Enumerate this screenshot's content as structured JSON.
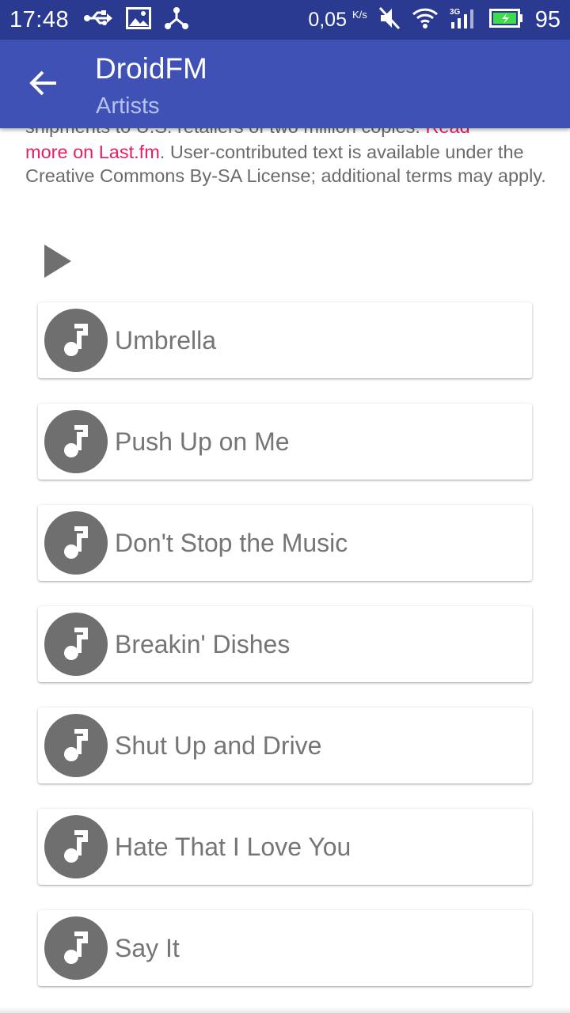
{
  "status_bar": {
    "time": "17:48",
    "speed_value": "0,05",
    "speed_unit": "K/s",
    "battery_level": "95",
    "icons": [
      "usb-icon",
      "image-icon",
      "share-icon",
      "mute-icon",
      "wifi-icon",
      "signal-3g-icon",
      "battery-charging-icon"
    ]
  },
  "app_bar": {
    "title": "DroidFM",
    "subtitle": "Artists",
    "back_icon": "arrow-back-icon"
  },
  "bio": {
    "clipped_text": "shipments to U.S. retailers of two million copies.",
    "read_more_clipped": "Read",
    "read_more": "more on Last.fm",
    "license_text": ". User-contributed text is available under the Creative Commons By-SA License; additional terms may apply."
  },
  "play_icon": "play-icon",
  "tracks": [
    {
      "title": "Umbrella",
      "icon": "music-note-icon"
    },
    {
      "title": "Push Up on Me",
      "icon": "music-note-icon"
    },
    {
      "title": "Don't Stop the Music",
      "icon": "music-note-icon"
    },
    {
      "title": "Breakin' Dishes",
      "icon": "music-note-icon"
    },
    {
      "title": "Shut Up and Drive",
      "icon": "music-note-icon"
    },
    {
      "title": "Hate That I Love You",
      "icon": "music-note-icon"
    },
    {
      "title": "Say It",
      "icon": "music-note-icon"
    }
  ],
  "colors": {
    "status_bar": "#2b3a91",
    "app_bar": "#3f51b5",
    "accent_link": "#e91e63",
    "icon_circle": "#6f6f6f",
    "track_text": "#757575"
  }
}
